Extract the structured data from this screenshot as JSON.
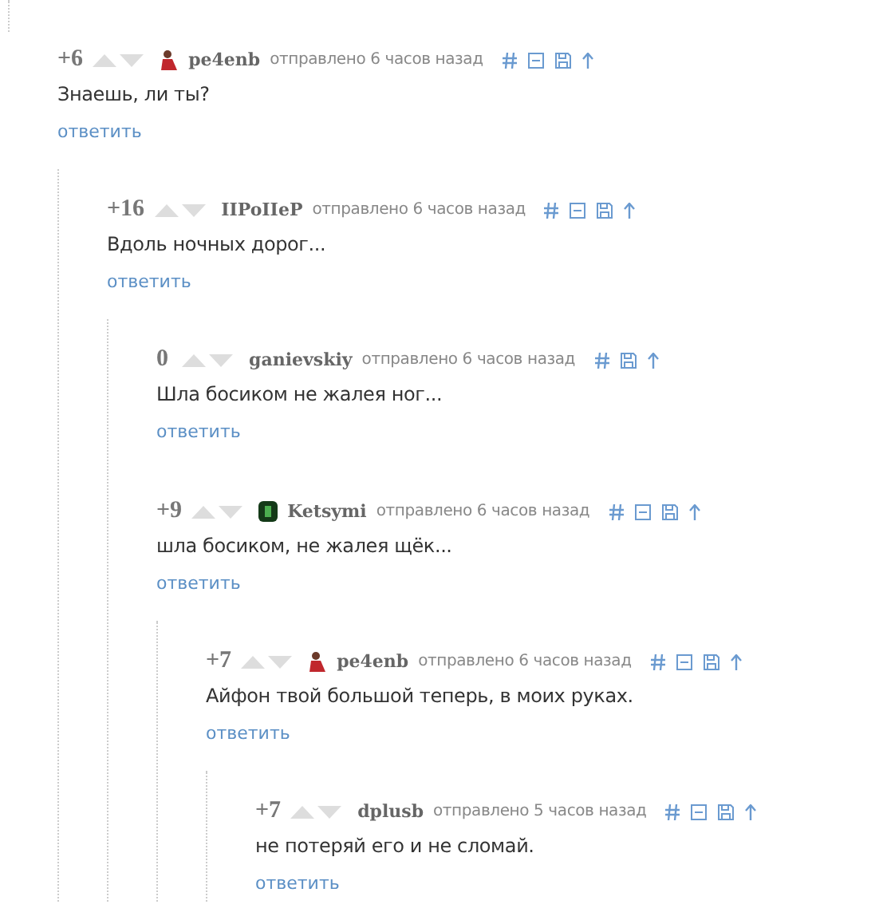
{
  "comments": [
    {
      "score": "+6",
      "avatar": {
        "kind": "person"
      },
      "author": "pe4enb",
      "meta": "отправлено 6 часов назад",
      "collapsible": true,
      "text": "Знаешь, ли ты?",
      "reply": "ответить",
      "children": [
        {
          "score": "+16",
          "author": "IIPoIIeP",
          "meta": "отправлено 6 часов назад",
          "collapsible": true,
          "text": "Вдоль ночных дорог...",
          "reply": "ответить",
          "children": [
            {
              "score": "0",
              "author": "ganievskiy",
              "meta": "отправлено 6 часов назад",
              "collapsible": false,
              "text": "Шла босиком не жалея ног...",
              "reply": "ответить"
            },
            {
              "score": "+9",
              "avatar": {
                "kind": "green"
              },
              "author": "Ketsymi",
              "meta": "отправлено 6 часов назад",
              "collapsible": true,
              "text": "шла босиком, не жалея щёк...",
              "reply": "ответить",
              "children": [
                {
                  "score": "+7",
                  "avatar": {
                    "kind": "person"
                  },
                  "author": "pe4enb",
                  "meta": "отправлено 6 часов назад",
                  "collapsible": true,
                  "text": "Айфон твой большой теперь, в моих руках.",
                  "reply": "ответить",
                  "children": [
                    {
                      "score": "+7",
                      "author": "dplusb",
                      "meta": "отправлено 5 часов назад",
                      "collapsible": true,
                      "text": "не потеряй его и не сломай.",
                      "reply": "ответить"
                    }
                  ]
                }
              ]
            }
          ]
        }
      ]
    }
  ]
}
